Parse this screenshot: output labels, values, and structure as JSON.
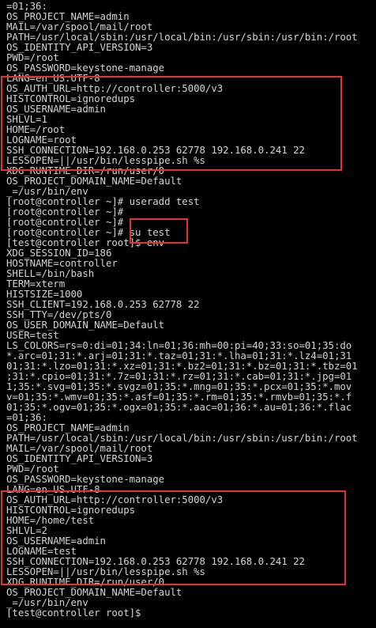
{
  "terminal": {
    "lines": [
      "=01;36:",
      "OS_PROJECT_NAME=admin",
      "MAIL=/var/spool/mail/root",
      "PATH=/usr/local/sbin:/usr/local/bin:/usr/sbin:/usr/bin:/root",
      "OS_IDENTITY_API_VERSION=3",
      "PWD=/root",
      "OS_PASSWORD=keystone-manage",
      "LANG=en_US.UTF-8",
      "OS_AUTH_URL=http://controller:5000/v3",
      "HISTCONTROL=ignoredups",
      "OS_USERNAME=admin",
      "SHLVL=1",
      "HOME=/root",
      "LOGNAME=root",
      "SSH_CONNECTION=192.168.0.253 62778 192.168.0.241 22",
      "LESSOPEN=||/usr/bin/lesspipe.sh %s",
      "XDG_RUNTIME_DIR=/run/user/0",
      "OS_PROJECT_DOMAIN_NAME=Default",
      "_=/usr/bin/env",
      "[root@controller ~]# useradd test",
      "[root@controller ~]#",
      "[root@controller ~]#",
      "[root@controller ~]# su test",
      "[test@controller root]$ env",
      "XDG_SESSION_ID=186",
      "HOSTNAME=controller",
      "SHELL=/bin/bash",
      "TERM=xterm",
      "HISTSIZE=1000",
      "SSH_CLIENT=192.168.0.253 62778 22",
      "SSH_TTY=/dev/pts/0",
      "OS_USER_DOMAIN_NAME=Default",
      "USER=test",
      "LS_COLORS=rs=0:di=01;34:ln=01;36:mh=00:pi=40;33:so=01;35:do",
      "*.arc=01;31:*.arj=01;31:*.taz=01;31:*.lha=01;31:*.lz4=01;31",
      "01;31:*.lzo=01;31:*.xz=01;31:*.bz2=01;31:*.bz=01;31:*.tbz=01",
      ";31:*.cpio=01;31:*.7z=01;31:*.rz=01;31:*.cab=01;31:*.jpg=01",
      "1;35:*.svg=01;35:*.svgz=01;35:*.mng=01;35:*.pcx=01;35:*.mov",
      "v=01;35:*.wmv=01;35:*.asf=01;35:*.rm=01;35:*.rmvb=01;35:*.f",
      "01;35:*.ogv=01;35:*.ogx=01;35:*.aac=01;36:*.au=01;36:*.flac",
      "=01;36:",
      "OS_PROJECT_NAME=admin",
      "PATH=/usr/local/sbin:/usr/local/bin:/usr/sbin:/usr/bin:/root",
      "MAIL=/var/spool/mail/root",
      "OS_IDENTITY_API_VERSION=3",
      "PWD=/root",
      "OS_PASSWORD=keystone-manage",
      "LANG=en_US.UTF-8",
      "OS_AUTH_URL=http://controller:5000/v3",
      "HISTCONTROL=ignoredups",
      "HOME=/home/test",
      "SHLVL=2",
      "OS_USERNAME=admin",
      "LOGNAME=test",
      "SSH_CONNECTION=192.168.0.253 62778 192.168.0.241 22",
      "LESSOPEN=||/usr/bin/lesspipe.sh %s",
      "XDG_RUNTIME_DIR=/run/user/0",
      "OS_PROJECT_DOMAIN_NAME=Default",
      "_=/usr/bin/env",
      "[test@controller root]$"
    ]
  },
  "colors": {
    "background": "#000000",
    "text": "#d4d4d4",
    "highlight": "#e8302c"
  }
}
